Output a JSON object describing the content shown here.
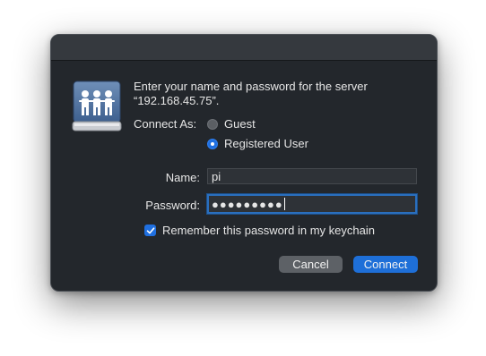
{
  "dialog": {
    "prompt_line1": "Enter your name and password for the server",
    "prompt_line2": "“192.168.45.75”.",
    "connect_as_label": "Connect As:",
    "options": [
      {
        "label": "Guest",
        "selected": false
      },
      {
        "label": "Registered User",
        "selected": true
      }
    ],
    "name_label": "Name:",
    "name_value": "pi",
    "password_label": "Password:",
    "password_value": "●●●●●●●●●",
    "remember_label": "Remember this password in my keychain",
    "remember_checked": true,
    "cancel_label": "Cancel",
    "connect_label": "Connect"
  },
  "icons": {
    "server": "server-users-icon",
    "check": "checkmark-icon"
  },
  "colors": {
    "accent": "#1e6fd8",
    "background": "#23272c",
    "titlebar": "#35393e"
  }
}
